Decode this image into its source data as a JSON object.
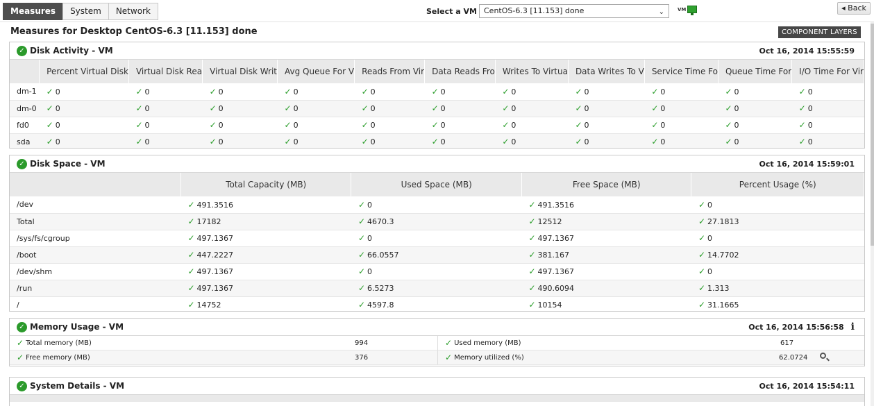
{
  "tabs": [
    "Measures",
    "System",
    "Network"
  ],
  "vm_selector": {
    "label": "Select a VM",
    "selected": "CentOS-6.3 [11.153] done",
    "icon_text": "VM"
  },
  "back_label": "Back",
  "page_title": "Measures for Desktop CentOS-6.3 [11.153] done",
  "component_layers": "COMPONENT LAYERS",
  "disk_activity": {
    "title": "Disk Activity - VM",
    "timestamp": "Oct 16, 2014 15:55:59",
    "columns": [
      "Percent Virtual Disk",
      "Virtual Disk Rea",
      "Virtual Disk Writ",
      "Avg Queue For V",
      "Reads From Vir",
      "Data Reads Fro",
      "Writes To Virtua",
      "Data Writes To V",
      "Service Time Fo",
      "Queue Time For",
      "I/O Time For Vir"
    ],
    "rows": [
      {
        "name": "dm-1",
        "values": [
          "0",
          "0",
          "0",
          "0",
          "0",
          "0",
          "0",
          "0",
          "0",
          "0",
          "0"
        ]
      },
      {
        "name": "dm-0",
        "values": [
          "0",
          "0",
          "0",
          "0",
          "0",
          "0",
          "0",
          "0",
          "0",
          "0",
          "0"
        ]
      },
      {
        "name": "fd0",
        "values": [
          "0",
          "0",
          "0",
          "0",
          "0",
          "0",
          "0",
          "0",
          "0",
          "0",
          "0"
        ]
      },
      {
        "name": "sda",
        "values": [
          "0",
          "0",
          "0",
          "0",
          "0",
          "0",
          "0",
          "0",
          "0",
          "0",
          "0"
        ]
      }
    ]
  },
  "disk_space": {
    "title": "Disk Space - VM",
    "timestamp": "Oct 16, 2014 15:59:01",
    "columns": [
      "Total Capacity (MB)",
      "Used Space (MB)",
      "Free Space (MB)",
      "Percent Usage (%)"
    ],
    "rows": [
      {
        "name": "/dev",
        "values": [
          "491.3516",
          "0",
          "491.3516",
          "0"
        ]
      },
      {
        "name": "Total",
        "values": [
          "17182",
          "4670.3",
          "12512",
          "27.1813"
        ]
      },
      {
        "name": "/sys/fs/cgroup",
        "values": [
          "497.1367",
          "0",
          "497.1367",
          "0"
        ]
      },
      {
        "name": "/boot",
        "values": [
          "447.2227",
          "66.0557",
          "381.167",
          "14.7702"
        ]
      },
      {
        "name": "/dev/shm",
        "values": [
          "497.1367",
          "0",
          "497.1367",
          "0"
        ]
      },
      {
        "name": "/run",
        "values": [
          "497.1367",
          "6.5273",
          "490.6094",
          "1.313"
        ]
      },
      {
        "name": "/",
        "values": [
          "14752",
          "4597.8",
          "10154",
          "31.1665"
        ]
      }
    ]
  },
  "memory_usage": {
    "title": "Memory Usage - VM",
    "timestamp": "Oct 16, 2014 15:56:58",
    "info_icon": "i",
    "items": [
      {
        "label": "Total memory (MB)",
        "value": "994"
      },
      {
        "label": "Used memory (MB)",
        "value": "617"
      },
      {
        "label": "Free memory (MB)",
        "value": "376"
      },
      {
        "label": "Memory utilized (%)",
        "value": "62.0724"
      }
    ]
  },
  "system_details": {
    "title": "System Details - VM",
    "timestamp": "Oct 16, 2014 15:54:11"
  },
  "status_color": "#2b9a2b",
  "check_glyph": "✓",
  "icons": [
    "check-circle-icon",
    "check-icon",
    "monitor-icon",
    "back-arrow-icon",
    "chevron-down-icon",
    "info-icon",
    "magnifier-icon"
  ]
}
